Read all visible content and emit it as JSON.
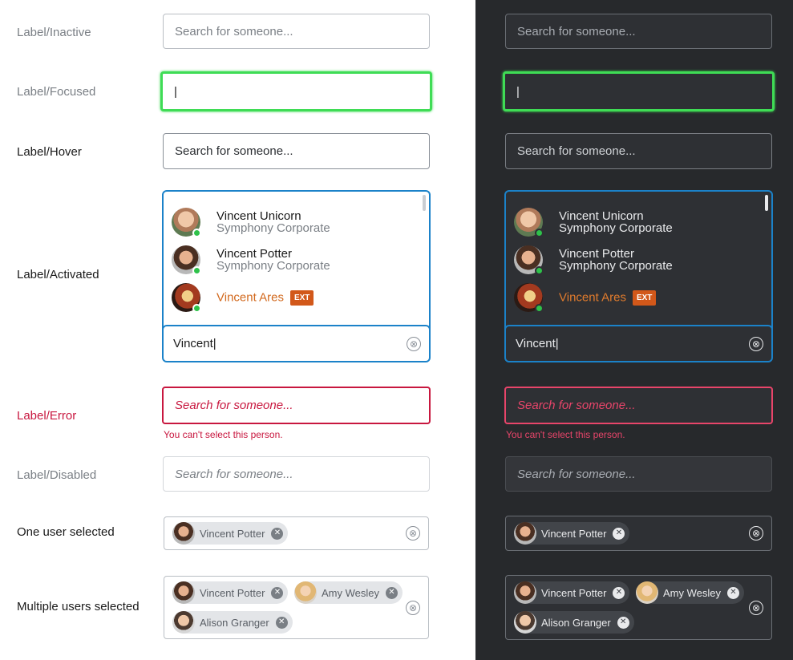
{
  "rows": {
    "inactive": {
      "label": "Label/Inactive",
      "placeholder": "Search for someone..."
    },
    "focused": {
      "label": "Label/Focused",
      "value": "|"
    },
    "hover": {
      "label": "Label/Hover",
      "placeholder": "Search for someone..."
    },
    "activated": {
      "label": "Label/Activated",
      "value": "Vincent|"
    },
    "error": {
      "label": "Label/Error",
      "placeholder": "Search for someone...",
      "message": "You can't select this person."
    },
    "disabled": {
      "label": "Label/Disabled",
      "placeholder": "Search for someone..."
    },
    "one_selected": {
      "label": "One user selected"
    },
    "multi_selected": {
      "label": "Multiple users selected"
    }
  },
  "results": [
    {
      "name": "Vincent Unicorn",
      "org": "Symphony Corporate",
      "avatar": "vincent-unicorn-avatar",
      "presence": "online"
    },
    {
      "name": "Vincent Potter",
      "org": "Symphony Corporate",
      "avatar": "vincent-potter-avatar",
      "presence": "online"
    },
    {
      "name": "Vincent Ares",
      "org": "",
      "badge": "EXT",
      "avatar": "vincent-ares-avatar",
      "presence": "online"
    }
  ],
  "chips": {
    "one": [
      "Vincent Potter"
    ],
    "multi": [
      "Vincent Potter",
      "Amy Wesley",
      "Alison Granger"
    ]
  },
  "icons": {
    "clear": "⊗",
    "chip_remove": "✕"
  },
  "colors": {
    "focus": "#3fdc55",
    "active": "#1b82c9",
    "error": "#c8173f",
    "external": "#d2581a",
    "presence": "#2ec24a",
    "dark_background": "#27292c"
  }
}
